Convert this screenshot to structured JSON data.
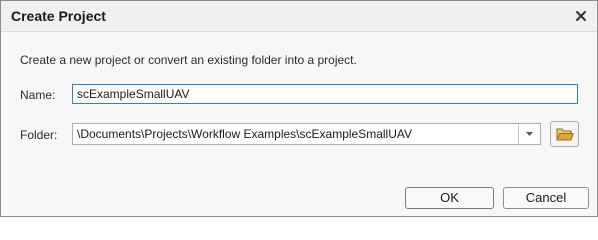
{
  "dialog": {
    "title": "Create Project",
    "description": "Create a new project or convert an existing folder into a project."
  },
  "name_field": {
    "label": "Name:",
    "value": "scExampleSmallUAV"
  },
  "folder_field": {
    "label": "Folder:",
    "value": "\\Documents\\Projects\\Workflow Examples\\scExampleSmallUAV"
  },
  "buttons": {
    "ok": "OK",
    "cancel": "Cancel"
  },
  "icons": {
    "close": "close-icon",
    "dropdown": "chevron-down-icon",
    "browse": "folder-icon"
  },
  "colors": {
    "input_focus_border": "#2f7fd0",
    "folder_icon": "#e0a63a"
  }
}
